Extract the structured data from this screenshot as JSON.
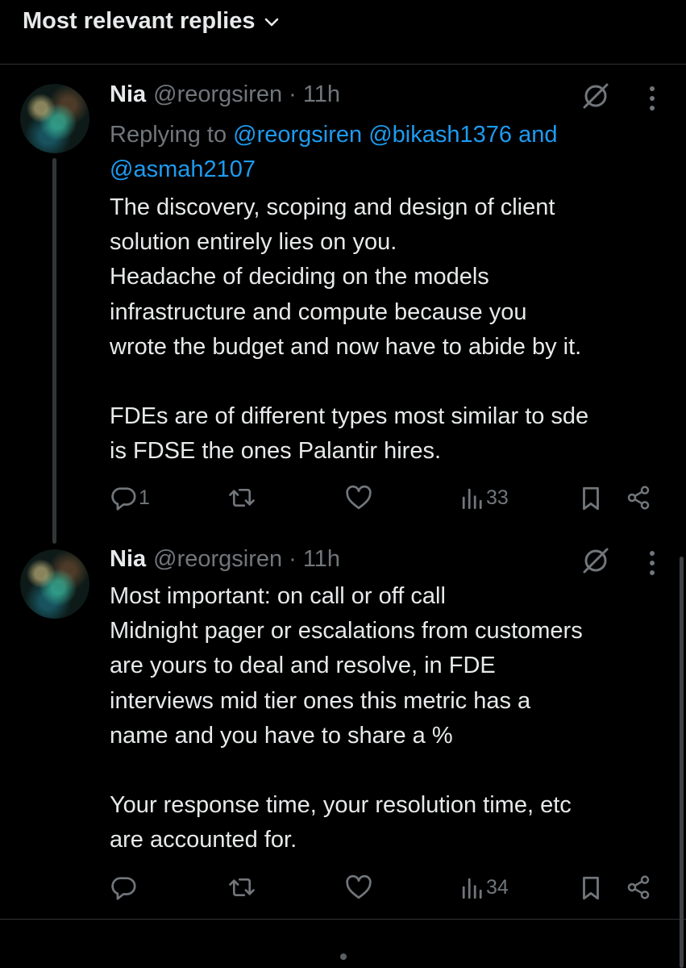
{
  "header": {
    "sort_label": "Most relevant replies"
  },
  "replies": [
    {
      "name": "Nia",
      "handle": "@reorgsiren",
      "dot": "·",
      "time": "11h",
      "replying_prefix": "Replying to ",
      "mention1": "@reorgsiren",
      "mention2": "@bikash1376",
      "mention_and": "and",
      "mention3": "@asmah2107",
      "body": "The discovery, scoping and design of client\nsolution entirely lies on you.\nHeadache of deciding on the models\ninfrastructure and compute because you\nwrote the budget and now have to abide by it.\n\nFDEs are of different types most similar to sde\nis FDSE the ones Palantir hires.",
      "reply_count": "1",
      "views": "33"
    },
    {
      "name": "Nia",
      "handle": "@reorgsiren",
      "dot": "·",
      "time": "11h",
      "body": "Most important: on call or off call\nMidnight pager or escalations from customers\nare yours to deal and resolve, in FDE\ninterviews mid tier ones this metric has a\nname and you have to share a %\n\nYour response time, your resolution time, etc\nare accounted for.",
      "reply_count": "",
      "views": "34"
    }
  ],
  "icons": {
    "reply": "reply-icon",
    "repost": "repost-icon",
    "like": "like-icon",
    "views": "views-icon",
    "bookmark": "bookmark-icon",
    "share": "share-icon",
    "grok": "grok-icon",
    "more": "more-icon"
  },
  "colors": {
    "background": "#000000",
    "text": "#e7e9ea",
    "muted": "#71767b",
    "link": "#1d9bf0"
  }
}
